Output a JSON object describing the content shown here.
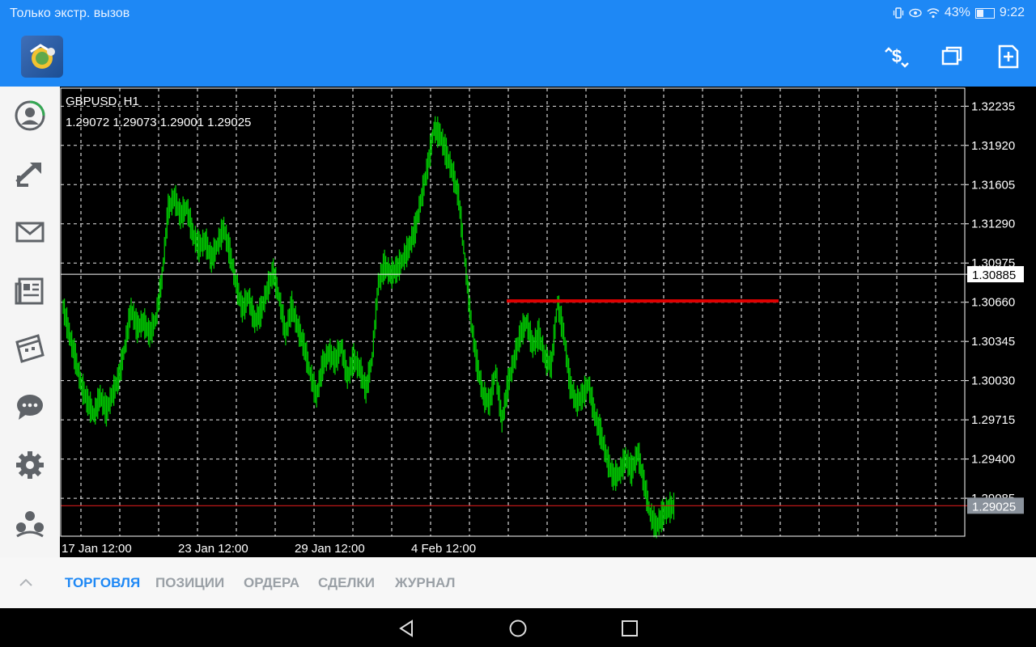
{
  "status_bar": {
    "carrier_text": "Только экстр. вызов",
    "battery": "43%",
    "battery_level": 0.43,
    "time": "9:22",
    "icons": [
      "vibrate-icon",
      "eye-icon",
      "wifi-icon",
      "battery-icon"
    ]
  },
  "app_bar": {
    "logo_icon": "metatrader-logo-icon",
    "actions": [
      "currency-exchange-icon",
      "windows-icon",
      "new-order-icon"
    ]
  },
  "sidebar": {
    "items": [
      {
        "name": "account-icon"
      },
      {
        "name": "trade-arrow-icon"
      },
      {
        "name": "mail-icon"
      },
      {
        "name": "news-icon"
      },
      {
        "name": "calendar-icon"
      },
      {
        "name": "chat-icon"
      },
      {
        "name": "settings-icon"
      },
      {
        "name": "community-icon"
      }
    ]
  },
  "chart": {
    "symbol": "GBPUSD, H1",
    "ohlc": "1.29072 1.29073 1.29001 1.29025",
    "colors": {
      "background": "#000000",
      "candle": "#00c800",
      "grid": "#ffffff",
      "bid_line": "#d11b1b",
      "user_line": "#e00000",
      "crosshair": "#ffffff"
    }
  },
  "chart_data": {
    "type": "line",
    "title": "GBPUSD, H1",
    "y_tick_labels": [
      "1.32235",
      "1.31920",
      "1.31605",
      "1.31290",
      "1.30975",
      "1.30660",
      "1.30345",
      "1.30030",
      "1.29715",
      "1.29400",
      "1.29085"
    ],
    "x_tick_labels": [
      "17 Jan 12:00",
      "23 Jan 12:00",
      "29 Jan 12:00",
      "4 Feb 12:00"
    ],
    "ylim": [
      1.2878,
      1.3238
    ],
    "grid": true,
    "crosshair_price": "1.30885",
    "current_price": "1.29025",
    "horizontal_line_price": 1.3067,
    "series": [
      {
        "values": [
          1.3062,
          1.304,
          1.302,
          1.2998,
          1.2985,
          1.2975,
          1.299,
          1.2978,
          1.2992,
          1.3005,
          1.303,
          1.306,
          1.3045,
          1.305,
          1.304,
          1.3052,
          1.3085,
          1.314,
          1.315,
          1.3135,
          1.3142,
          1.312,
          1.311,
          1.3115,
          1.31,
          1.3112,
          1.3125,
          1.3105,
          1.308,
          1.306,
          1.307,
          1.305,
          1.3058,
          1.3075,
          1.309,
          1.3068,
          1.304,
          1.3062,
          1.3045,
          1.303,
          1.3008,
          1.299,
          1.3015,
          1.3025,
          1.3018,
          1.303,
          1.3005,
          1.302,
          1.3012,
          1.2995,
          1.302,
          1.308,
          1.3095,
          1.3088,
          1.3092,
          1.31,
          1.311,
          1.3125,
          1.315,
          1.3175,
          1.3205,
          1.32,
          1.3185,
          1.317,
          1.315,
          1.31,
          1.305,
          1.3015,
          1.299,
          1.2985,
          1.301,
          1.297,
          1.3,
          1.302,
          1.304,
          1.305,
          1.303,
          1.304,
          1.302,
          1.3015,
          1.3065,
          1.304,
          1.3,
          1.2985,
          1.299,
          1.3,
          1.2975,
          1.296,
          1.294,
          1.2925,
          1.2928,
          1.294,
          1.293,
          1.2945,
          1.292,
          1.2895,
          1.2885,
          1.2895,
          1.29,
          1.2902
        ]
      }
    ]
  },
  "bottom_tabs": {
    "chevron_icon": "chevron-up-icon",
    "tabs": [
      "ТОРГОВЛЯ",
      "ПОЗИЦИИ",
      "ОРДЕРА",
      "СДЕЛКИ",
      "ЖУРНАЛ"
    ],
    "active": 0
  },
  "nav_bar": {
    "buttons": [
      "back-icon",
      "home-icon",
      "recents-icon"
    ]
  }
}
